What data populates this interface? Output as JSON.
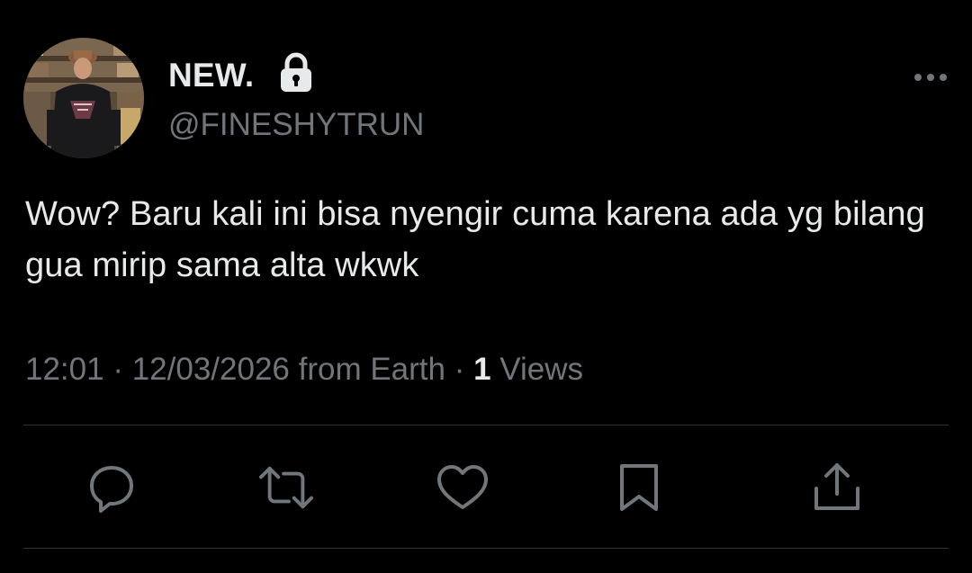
{
  "user": {
    "display_name": "NEW.",
    "handle": "@FINESHYTRUN",
    "verified_lock_icon": "lock-icon",
    "avatar_icon": "avatar"
  },
  "tweet": {
    "text": "Wow? Baru kali ini bisa nyengir cuma karena ada yg bilang gua mirip sama alta wkwk"
  },
  "meta": {
    "time": "12:01",
    "separator1": " · ",
    "date": "12/03/2026",
    "source": " from Earth",
    "separator2": " · ",
    "views_count": "1",
    "views_label": " Views"
  },
  "actions": [
    {
      "name": "reply",
      "icon": "reply-icon"
    },
    {
      "name": "retweet",
      "icon": "retweet-icon"
    },
    {
      "name": "like",
      "icon": "heart-icon"
    },
    {
      "name": "bookmark",
      "icon": "bookmark-icon"
    },
    {
      "name": "share",
      "icon": "share-icon"
    }
  ],
  "more_menu_icon": "more-icon",
  "colors": {
    "background": "#000000",
    "primary_text": "#e7e9ea",
    "secondary_text": "#71767b",
    "divider": "#2f3336"
  }
}
